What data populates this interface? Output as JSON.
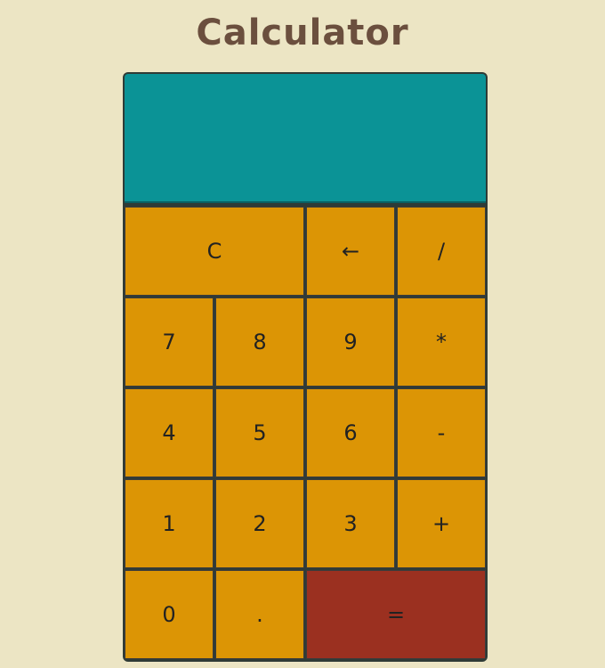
{
  "page": {
    "title": "Calculator"
  },
  "display": {
    "value": ""
  },
  "keys": {
    "clear": "C",
    "backspace": "←",
    "divide": "/",
    "seven": "7",
    "eight": "8",
    "nine": "9",
    "multiply": "*",
    "four": "4",
    "five": "5",
    "six": "6",
    "subtract": "-",
    "one": "1",
    "two": "2",
    "three": "3",
    "add": "+",
    "zero": "0",
    "decimal": ".",
    "equals": "="
  },
  "colors": {
    "background": "#ece5c4",
    "title": "#6b4f3e",
    "display": "#0b9396",
    "key": "#dc9505",
    "equals_key": "#9b3020"
  }
}
